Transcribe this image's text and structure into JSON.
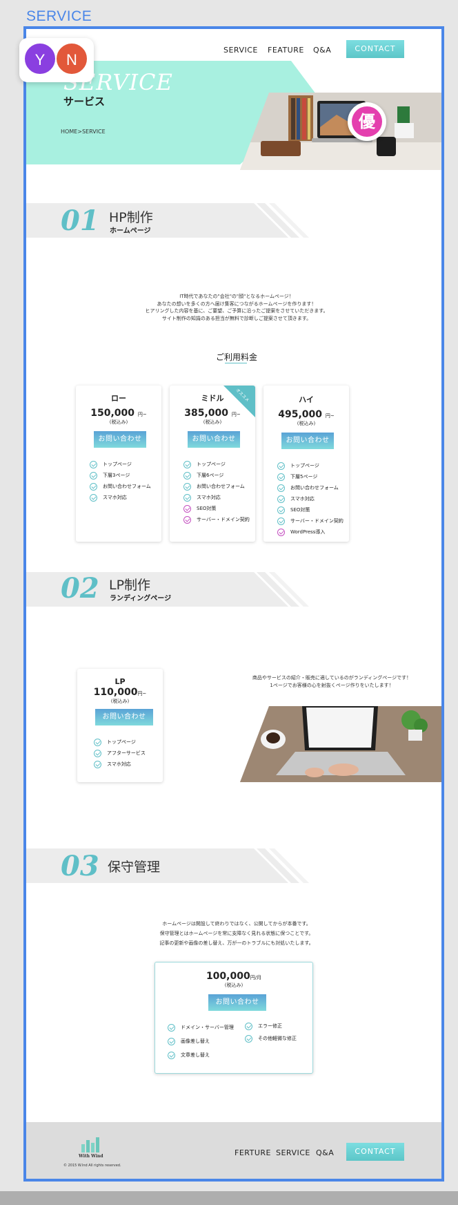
{
  "frame_label": "SERVICE",
  "avatars": [
    {
      "initial": "Y",
      "color": "#8a3fe0"
    },
    {
      "initial": "N",
      "color": "#e2583a"
    }
  ],
  "nav": {
    "service": "SERVICE",
    "feature": "FEATURE",
    "qa": "Q&A",
    "contact": "CONTACT"
  },
  "hero": {
    "title": "SERVICE",
    "subtitle": "サービス",
    "breadcrumb": "HOME>SERVICE",
    "badge": "優"
  },
  "section1": {
    "number": "01",
    "title": "HP制作",
    "subtitle": "ホームページ",
    "description": [
      "IT時代であなたの\"会社\"の\"顔\"となるホームページ！",
      "あなたの想いを多くの方へ届け集客につながるホームページを作ります！",
      "ヒアリングした内容を基に、ご要望、ご予算に沿ったご提案をさせていただきます。",
      "サイト制作の知識のある担当が無料で診断しご提案させて頂きます。"
    ],
    "pricing_title": "ご利用料金",
    "recommend": "オススメ",
    "plans": [
      {
        "name": "ロー",
        "price": "150,000",
        "unit": "円~",
        "tax": "(税込み)",
        "button": "お問い合わせ",
        "features": [
          "トップページ",
          "下層3ページ",
          "お問い合わせフォーム",
          "スマホ対応"
        ],
        "pink": []
      },
      {
        "name": "ミドル",
        "price": "385,000",
        "unit": "円~",
        "tax": "(税込み)",
        "button": "お問い合わせ",
        "features": [
          "トップページ",
          "下層6ページ",
          "お問い合わせフォーム",
          "スマホ対応",
          "SEO対策",
          "サーバー・ドメイン契約"
        ],
        "pink": [
          4,
          5
        ]
      },
      {
        "name": "ハイ",
        "price": "495,000",
        "unit": "円~",
        "tax": "(税込み)",
        "button": "お問い合わせ",
        "features": [
          "トップページ",
          "下層5ページ",
          "お問い合わせフォーム",
          "スマホ対応",
          "SEO対策",
          "サーバー・ドメイン契約",
          "WordPress導入"
        ],
        "pink": [
          6
        ]
      }
    ]
  },
  "section2": {
    "number": "02",
    "title": "LP制作",
    "subtitle": "ランディングページ",
    "description": [
      "商品やサービスの紹介・販売に適しているのがランディングページです！",
      "1ページでお客様の心を射抜くページ作りをいたします！"
    ],
    "plan": {
      "name": "LP",
      "price": "110,000",
      "unit": "円~",
      "tax": "(税込み)",
      "button": "お問い合わせ",
      "features": [
        "トップページ",
        "アフターサービス",
        "スマホ対応"
      ]
    }
  },
  "section3": {
    "number": "03",
    "title": "保守管理",
    "description": [
      "ホームページは開設して終わりではなく、公開してからが本番です。",
      "保守管理とはホームページを常に支障なく見れる状態に保つことです。",
      "記事の更新や画像の差し替え、万が一のトラブルにも対処いたします。"
    ],
    "plan": {
      "price": "100,000",
      "unit": "円/月",
      "tax": "(税込み)",
      "button": "お問い合わせ",
      "features_left": [
        "ドメイン・サーバー管理",
        "画像差し替え",
        "文章差し替え"
      ],
      "features_right": [
        "エラー修正",
        "その他軽微な修正"
      ]
    }
  },
  "footer": {
    "logo_text": "With Wind",
    "copyright": "© 2015 W.Ind All rights reserved.",
    "nav": {
      "feature": "FERTURE",
      "service": "SERVICE",
      "qa": "Q&A",
      "contact": "CONTACT"
    }
  }
}
